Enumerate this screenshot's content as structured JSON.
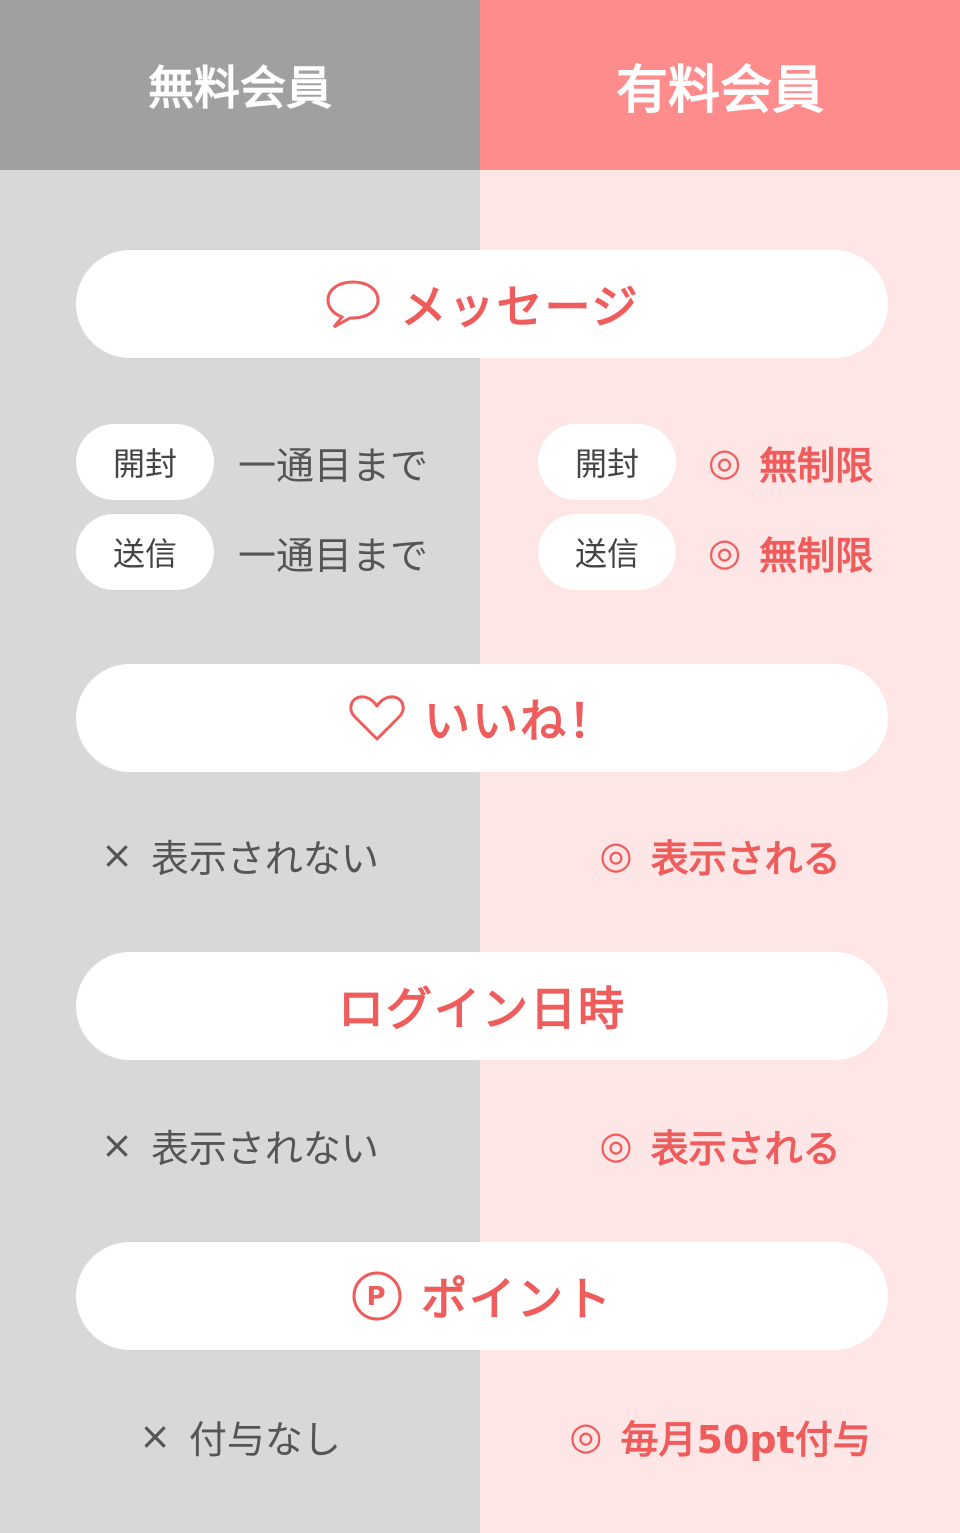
{
  "header": {
    "free_label": "無料会員",
    "paid_label": "有料会員"
  },
  "sections": {
    "message": {
      "title": "メッセージ",
      "icon": "speech-bubble-icon",
      "rows": [
        {
          "tag": "開封",
          "free": "一通目まで",
          "paid_mark": "◎",
          "paid": "無制限"
        },
        {
          "tag": "送信",
          "free": "一通目まで",
          "paid_mark": "◎",
          "paid": "無制限"
        }
      ]
    },
    "like": {
      "title": "いいね！",
      "icon": "heart-icon",
      "free_mark": "×",
      "free": "表示されない",
      "paid_mark": "◎",
      "paid": "表示される"
    },
    "login": {
      "title": "ログイン日時",
      "free_mark": "×",
      "free": "表示されない",
      "paid_mark": "◎",
      "paid": "表示される"
    },
    "point": {
      "title": "ポイント",
      "icon": "point-p-icon",
      "icon_letter": "P",
      "free_mark": "×",
      "free": "付与なし",
      "paid_mark": "◎",
      "paid": "毎月50pt付与"
    }
  },
  "colors": {
    "accent": "#ef5c5c",
    "free_bg": "#d8d8d8",
    "paid_bg": "#ffe6e6",
    "free_header": "#a0a0a0",
    "paid_header": "#ff8c8c"
  }
}
